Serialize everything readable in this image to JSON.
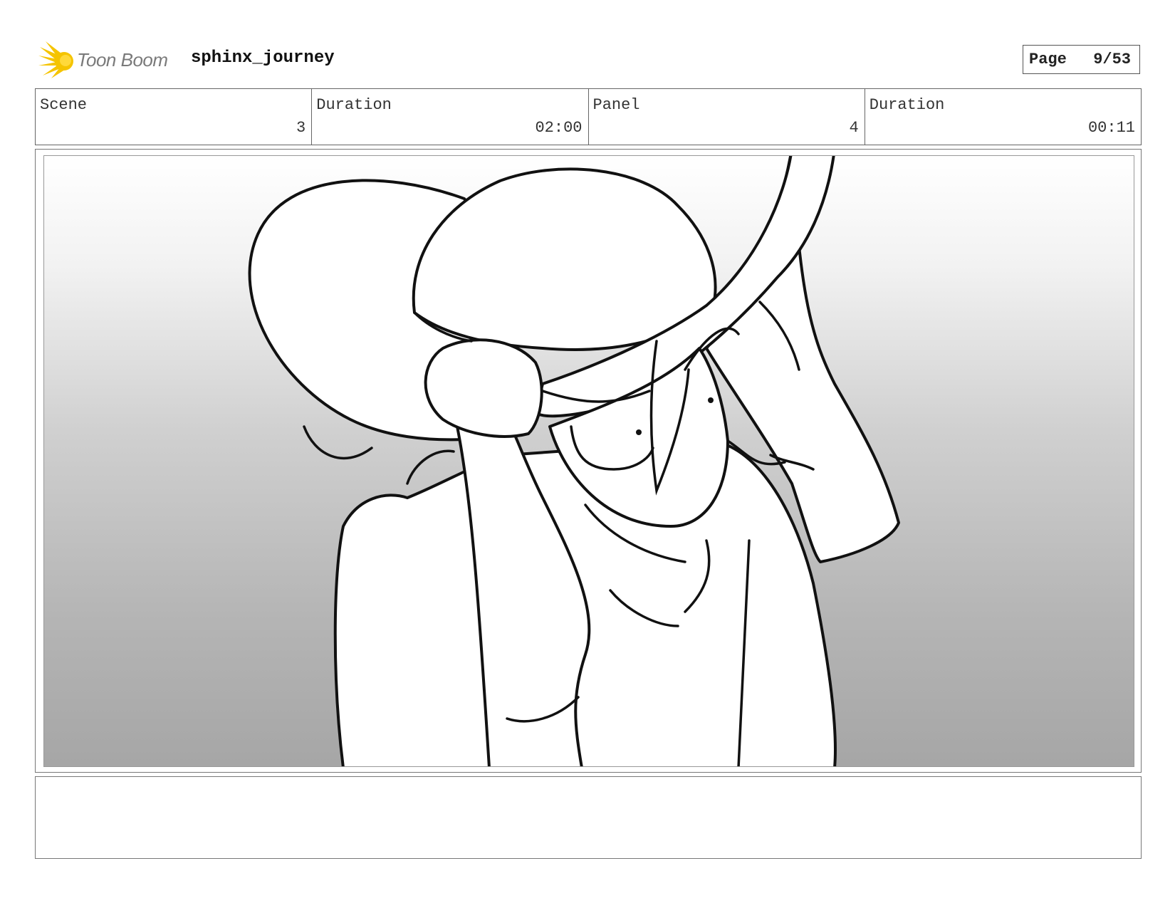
{
  "header": {
    "logo_text": "Toon Boom",
    "project_title": "sphinx_journey",
    "page_label": "Page",
    "page_value": "9/53"
  },
  "info": {
    "scene_label": "Scene",
    "scene_value": "3",
    "scene_duration_label": "Duration",
    "scene_duration_value": "02:00",
    "panel_label": "Panel",
    "panel_value": "4",
    "panel_duration_label": "Duration",
    "panel_duration_value": "00:11"
  },
  "notes": {
    "text": ""
  },
  "icons": {
    "logo": "toon-boom-sun-icon",
    "drawing": "storyboard-sketch-character-with-hat"
  },
  "colors": {
    "logo_yellow": "#f5c400",
    "logo_text": "#7a7a7a",
    "line": "#111111"
  }
}
